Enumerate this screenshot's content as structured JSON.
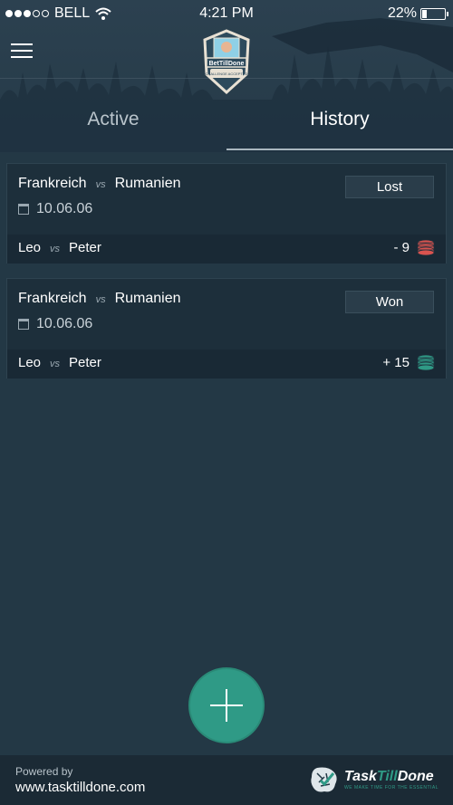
{
  "status_bar": {
    "carrier": "BELL",
    "time": "4:21 PM",
    "battery": "22%",
    "battery_level": 0.22
  },
  "header": {
    "logo_text": "BetTillDone",
    "logo_sub": "CHALLENGE ACCEPTED"
  },
  "tabs": [
    {
      "label": "Active"
    },
    {
      "label": "History"
    }
  ],
  "bets": [
    {
      "team1": "Frankreich",
      "vs": "vs",
      "team2": "Rumanien",
      "date": "10.06.06",
      "result": "Lost",
      "player1": "Leo",
      "player2": "Peter",
      "amount": "- 9",
      "coin_color": "#d9534f"
    },
    {
      "team1": "Frankreich",
      "vs": "vs",
      "team2": "Rumanien",
      "date": "10.06.06",
      "result": "Won",
      "player1": "Leo",
      "player2": "Peter",
      "amount": "+ 15",
      "coin_color": "#2f9a86"
    }
  ],
  "footer": {
    "powered_by": "Powered by",
    "url": "www.tasktilldone.com",
    "brand_task": "Task",
    "brand_till": "Till",
    "brand_done": "Done",
    "brand_tagline": "WE MAKE TIME FOR THE ESSENTIAL"
  }
}
